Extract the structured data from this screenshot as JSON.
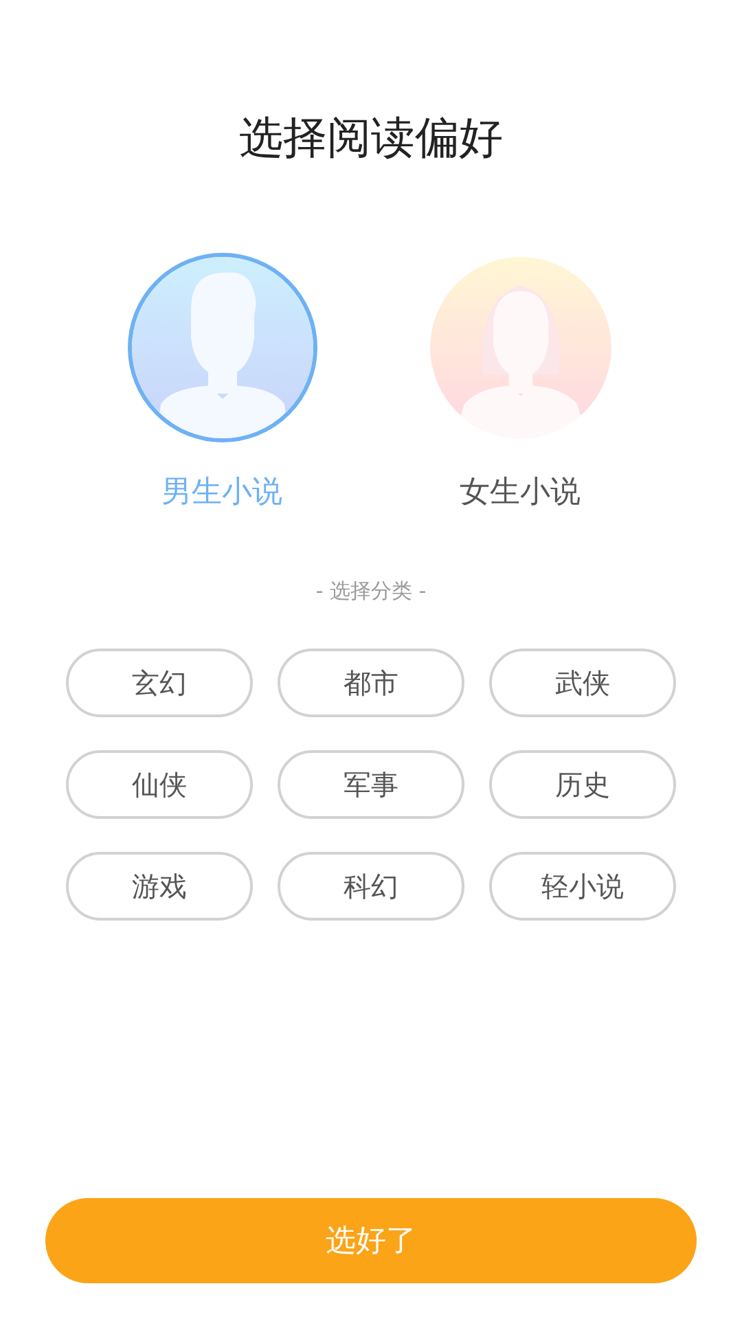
{
  "title": "选择阅读偏好",
  "genders": [
    {
      "kind": "male",
      "label": "男生小说",
      "selected": true
    },
    {
      "kind": "female",
      "label": "女生小说",
      "selected": false
    }
  ],
  "category_heading": "- 选择分类 -",
  "categories": [
    "玄幻",
    "都市",
    "武侠",
    "仙侠",
    "军事",
    "历史",
    "游戏",
    "科幻",
    "轻小说"
  ],
  "confirm_button": "选好了"
}
